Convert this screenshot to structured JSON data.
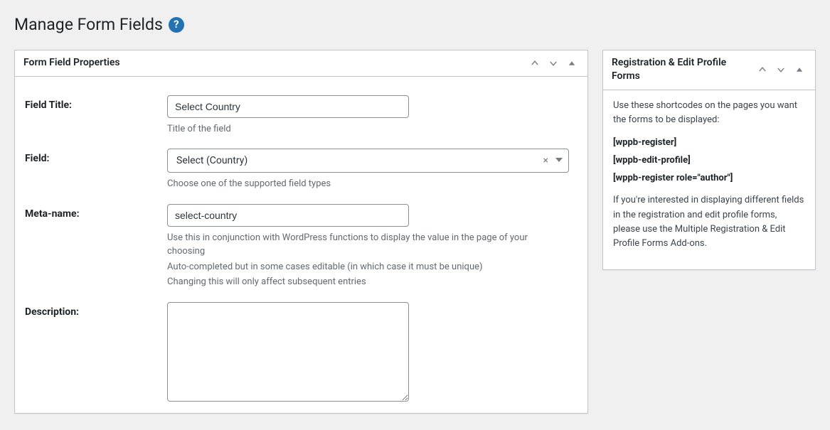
{
  "page": {
    "title": "Manage Form Fields"
  },
  "panel_main": {
    "title": "Form Field Properties",
    "fields": {
      "title": {
        "label": "Field Title:",
        "value": "Select Country",
        "help": "Title of the field"
      },
      "field_type": {
        "label": "Field:",
        "value": "Select (Country)",
        "help": "Choose one of the supported field types"
      },
      "meta_name": {
        "label": "Meta-name:",
        "value": "select-country",
        "help1": "Use this in conjunction with WordPress functions to display the value in the page of your choosing",
        "help2": "Auto-completed but in some cases editable (in which case it must be unique)",
        "help3": "Changing this will only affect subsequent entries"
      },
      "description": {
        "label": "Description:",
        "value": ""
      }
    }
  },
  "panel_side": {
    "title": "Registration & Edit Profile Forms",
    "intro": "Use these shortcodes on the pages you want the forms to be displayed:",
    "shortcodes": [
      "[wppb-register]",
      "[wppb-edit-profile]",
      "[wppb-register role=\"author\"]"
    ],
    "outro": "If you're interested in displaying different fields in the registration and edit profile forms, please use the Multiple Registration & Edit Profile Forms Add-ons."
  }
}
